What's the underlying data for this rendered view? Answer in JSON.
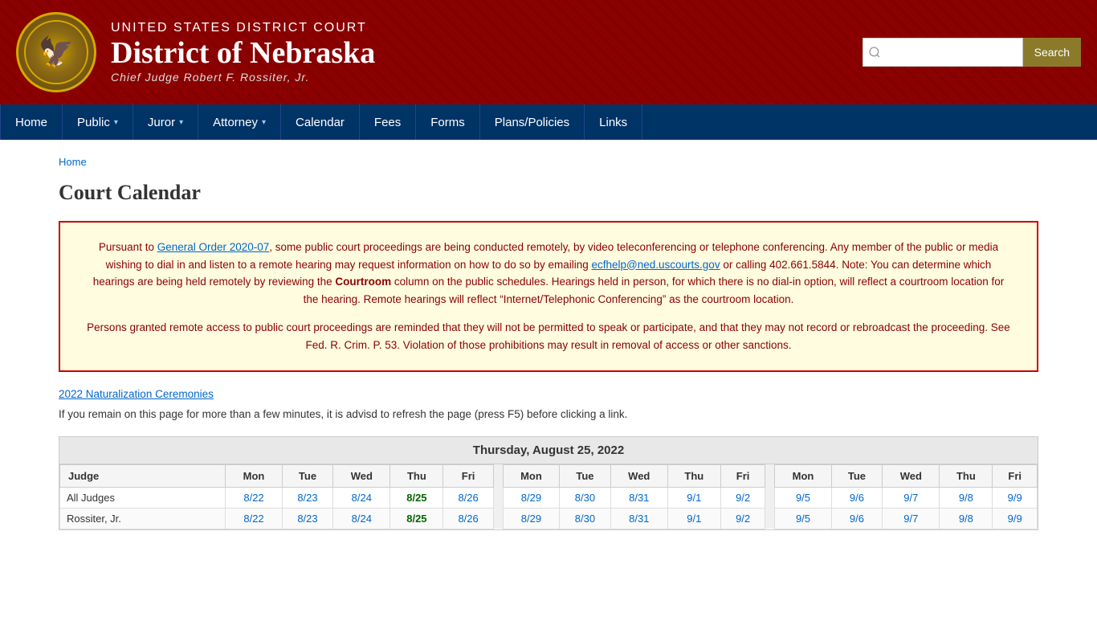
{
  "header": {
    "court_name_sm": "UNITED STATES DISTRICT COURT",
    "court_name_lg": "District of Nebraska",
    "chief_judge": "Chief Judge Robert F. Rossiter, Jr.",
    "seal_icon": "🦅",
    "search_placeholder": "",
    "search_button_label": "Search"
  },
  "nav": {
    "items": [
      {
        "label": "Home",
        "has_dropdown": false
      },
      {
        "label": "Public",
        "has_dropdown": true
      },
      {
        "label": "Juror",
        "has_dropdown": true
      },
      {
        "label": "Attorney",
        "has_dropdown": true
      },
      {
        "label": "Calendar",
        "has_dropdown": false
      },
      {
        "label": "Fees",
        "has_dropdown": false
      },
      {
        "label": "Forms",
        "has_dropdown": false
      },
      {
        "label": "Plans/Policies",
        "has_dropdown": false
      },
      {
        "label": "Links",
        "has_dropdown": false
      }
    ]
  },
  "breadcrumb": {
    "home_label": "Home"
  },
  "page_title": "Court Calendar",
  "notice": {
    "paragraph1": "Pursuant to General Order 2020-07, some public court proceedings are being conducted remotely, by video teleconferencing or telephone conferencing. Any member of the public or media wishing to dial in and listen to a remote hearing may request information on how to do so by emailing ecfhelp@ned.uscourts.gov or calling 402.661.5844. Note: You can determine which hearings are being held remotely by reviewing the Courtroom column on the public schedules. Hearings held in person, for which there is no dial-in option, will reflect a courtroom location for the hearing. Remote hearings will reflect “Internet/Telephonic Conferencing” as the courtroom location.",
    "order_link_text": "General Order 2020-07",
    "email_link_text": "ecfhelp@ned.uscourts.gov",
    "paragraph2": "Persons granted remote access to public court proceedings are reminded that they will not be permitted to speak or participate, and that they may not record or rebroadcast the proceeding. See Fed. R. Crim. P. 53. Violation of those prohibitions may result in removal of access or other sanctions."
  },
  "naturalization_link": "2022 Naturalization Ceremonies",
  "refresh_note": "If you remain on this page for more than a few minutes, it is advisd to refresh the page (press F5) before clicking a link.",
  "calendar": {
    "title": "Thursday, August 25, 2022",
    "col_headers": [
      "Judge",
      "Mon",
      "Tue",
      "Wed",
      "Thu",
      "Fri",
      "",
      "Mon",
      "Tue",
      "Wed",
      "Thu",
      "Fri",
      "",
      "Mon",
      "Tue",
      "Wed",
      "Thu",
      "Fri"
    ],
    "rows": [
      {
        "judge": "All Judges",
        "dates": [
          "8/22",
          "8/23",
          "8/24",
          "8/25",
          "8/26",
          "",
          "8/29",
          "8/30",
          "8/31",
          "9/1",
          "9/2",
          "",
          "9/5",
          "9/6",
          "9/7",
          "9/8",
          "9/9"
        ],
        "bold_index": 3
      },
      {
        "judge": "Rossiter, Jr.",
        "dates": [
          "8/22",
          "8/23",
          "8/24",
          "8/25",
          "8/26",
          "",
          "8/29",
          "8/30",
          "8/31",
          "9/1",
          "9/2",
          "",
          "9/5",
          "9/6",
          "9/7",
          "9/8",
          "9/9"
        ],
        "bold_index": 3
      }
    ]
  }
}
